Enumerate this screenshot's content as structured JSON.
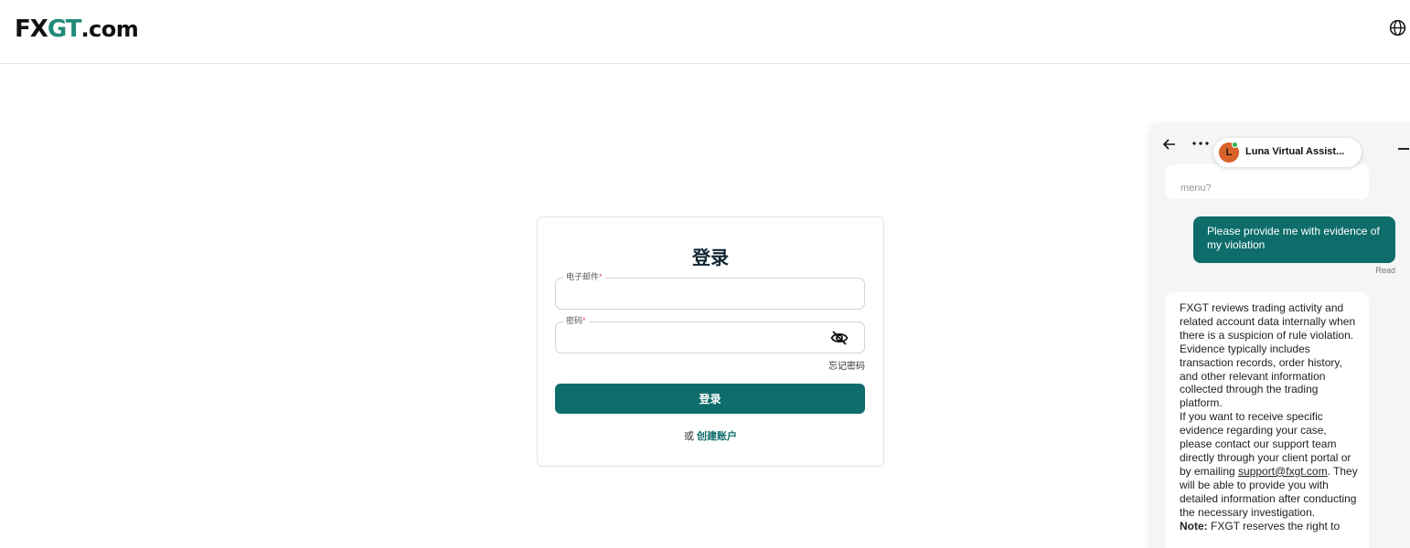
{
  "header": {
    "logo": {
      "part1": "FX",
      "part2": "GT",
      "part3": ".com"
    },
    "language_icon": "globe-icon"
  },
  "login": {
    "title": "登录",
    "email_label": "电子邮件",
    "password_label": "密码",
    "required_mark": "*",
    "email_value": "",
    "password_value": "",
    "visibility_icon": "eye-slash-icon",
    "forgot_password": "忘记密码",
    "submit_label": "登录",
    "or_text": "或",
    "create_account": "创建账户"
  },
  "colors": {
    "brand": "#0e6d6b",
    "logo_accent": "#1f8a78",
    "avatar": "#d9622b",
    "online": "#2db84d"
  },
  "chat": {
    "back_icon": "arrow-left-icon",
    "more_icon": "ellipsis-icon",
    "minimize_icon": "minimize-icon",
    "agent": {
      "initial": "L",
      "name": "Luna Virtual Assist..."
    },
    "previous_message_tail": "menu?",
    "user_message": "Please provide me with evidence of my violation",
    "read_status": "Read",
    "bot_message": {
      "para1": "FXGT reviews trading activity and related account data internally when there is a suspicion of rule violation. Evidence typically includes transaction records, order history, and other relevant information collected through the trading platform.",
      "para2_before": "If you want to receive specific evidence regarding your case, please contact our support team directly through your client portal or by emailing ",
      "email": "support@fxgt.com",
      "para2_after": ". They will be able to provide you with detailed information after conducting the necessary investigation.",
      "note_label": "Note:",
      "note_text": " FXGT reserves the right to"
    }
  }
}
